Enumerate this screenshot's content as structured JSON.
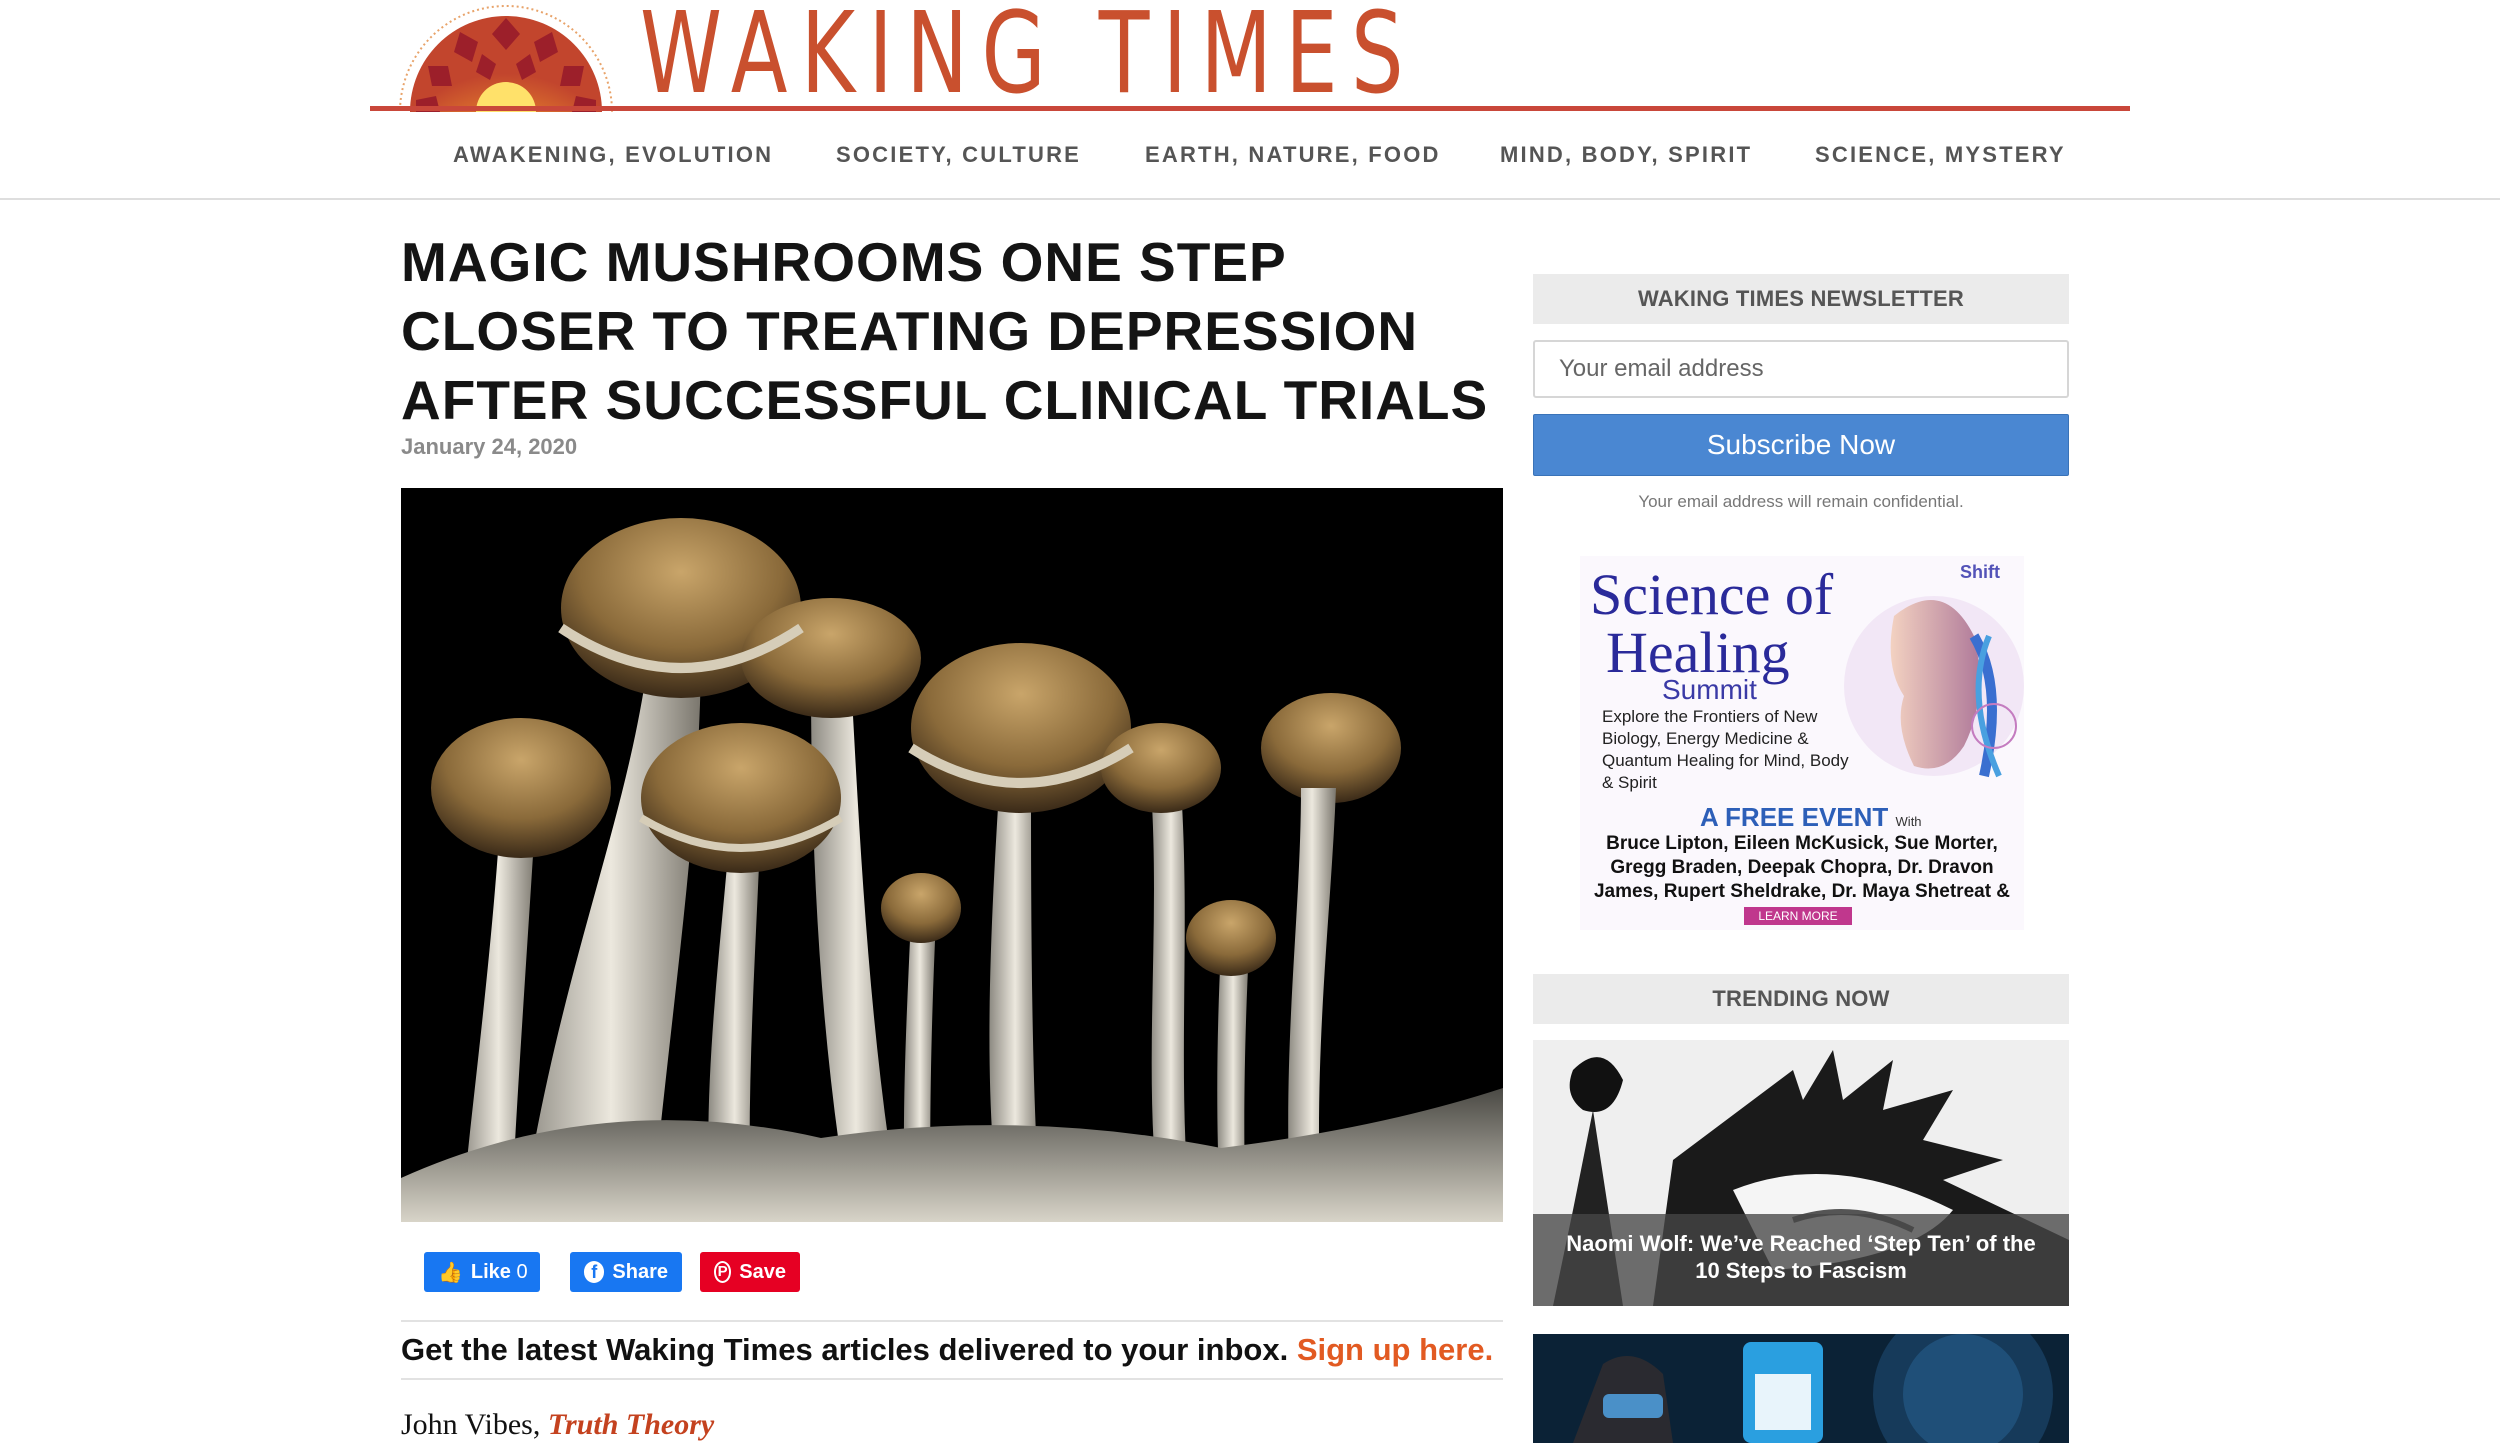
{
  "site": {
    "logo_text": "WAKING TIMES",
    "brand_color": "#c9502e"
  },
  "nav": {
    "items": [
      {
        "label": "AWAKENING, EVOLUTION"
      },
      {
        "label": "SOCIETY, CULTURE"
      },
      {
        "label": "EARTH, NATURE, FOOD"
      },
      {
        "label": "MIND, BODY, SPIRIT"
      },
      {
        "label": "SCIENCE, MYSTERY"
      }
    ]
  },
  "article": {
    "title": "MAGIC MUSHROOMS ONE STEP CLOSER TO TREATING DEPRESSION AFTER SUCCESSFUL CLINICAL TRIALS",
    "date": "January 24, 2020",
    "hero_image": "psilocybin-mushrooms",
    "social": {
      "like_label": "Like",
      "like_count": "0",
      "share_label": "Share",
      "save_label": "Save"
    },
    "cta": {
      "text": "Get the latest Waking Times articles delivered to your inbox.",
      "link": "Sign up here."
    },
    "byline": {
      "author": "John Vibes,",
      "source": "Truth Theory"
    }
  },
  "sidebar": {
    "newsletter": {
      "heading": "WAKING TIMES NEWSLETTER",
      "email_placeholder": "Your email address",
      "subscribe_label": "Subscribe Now",
      "note": "Your email address will remain confidential."
    },
    "ad": {
      "brand": "Shift",
      "title_line1": "Science of",
      "title_line2": "Healing",
      "subtitle": "Summit",
      "body": "Explore the Frontiers of New Biology, Energy Medicine & Quantum Healing for Mind, Body & Spirit",
      "free_event": "A FREE EVENT",
      "with": "With",
      "speakers": "Bruce Lipton, Eileen McKusick, Sue Morter, Gregg Braden, Deepak Chopra, Dr. Dravon James, Rupert Sheldrake, Dr. Maya Shetreat & More!",
      "learn_more": "LEARN MORE"
    },
    "trending": {
      "heading": "TRENDING NOW",
      "items": [
        {
          "caption": "Naomi Wolf: We’ve Reached ‘Step Ten’ of the 10 Steps to Fascism"
        }
      ]
    }
  }
}
